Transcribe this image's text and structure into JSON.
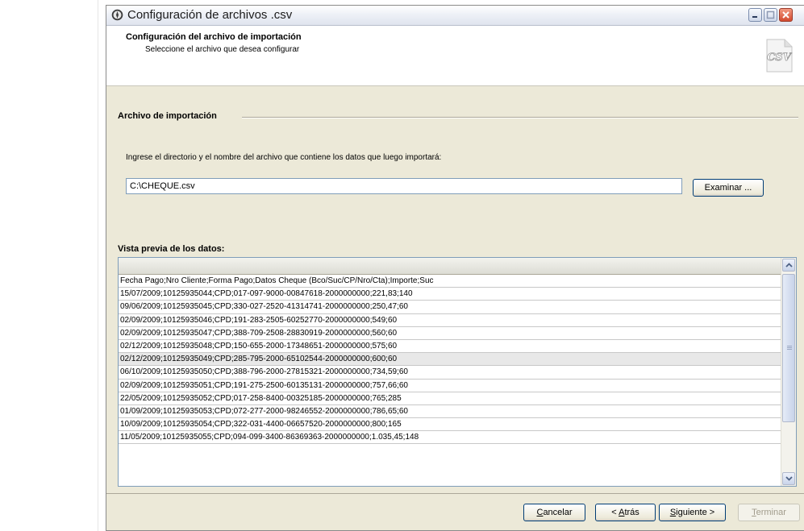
{
  "window": {
    "title": "Configuración de archivos .csv",
    "header_title": "Configuración del archivo de importación",
    "header_subtitle": "Seleccione el archivo que desea configurar",
    "icon_label": "CSV"
  },
  "import_section": {
    "title": "Archivo de importación",
    "instruction": "Ingrese el directorio y el nombre del archivo que contiene los datos que luego importará:",
    "path_value": "C:\\CHEQUE.csv",
    "browse_label": "Examinar ..."
  },
  "preview": {
    "title": "Vista previa de los datos:",
    "rows": [
      "Fecha Pago;Nro Cliente;Forma Pago;Datos Cheque (Bco/Suc/CP/Nro/Cta);Importe;Suc",
      "15/07/2009;10125935044;CPD;017-097-9000-00847618-2000000000;221,83;140",
      "09/06/2009;10125935045;CPD;330-027-2520-41314741-2000000000;250,47;60",
      "02/09/2009;10125935046;CPD;191-283-2505-60252770-2000000000;549;60",
      "02/09/2009;10125935047;CPD;388-709-2508-28830919-2000000000;560;60",
      "02/12/2009;10125935048;CPD;150-655-2000-17348651-2000000000;575;60",
      "02/12/2009;10125935049;CPD;285-795-2000-65102544-2000000000;600;60",
      "06/10/2009;10125935050;CPD;388-796-2000-27815321-2000000000;734,59;60",
      "02/09/2009;10125935051;CPD;191-275-2500-60135131-2000000000;757,66;60",
      "22/05/2009;10125935052;CPD;017-258-8400-00325185-2000000000;765;285",
      "01/09/2009;10125935053;CPD;072-277-2000-98246552-2000000000;786,65;60",
      "10/09/2009;10125935054;CPD;322-031-4400-06657520-2000000000;800;165",
      "11/05/2009;10125935055;CPD;094-099-3400-86369363-2000000000;1.035,45;148"
    ],
    "selected_row_index": 6
  },
  "footer": {
    "cancel_label": "Cancelar",
    "back_label": "< Atrás",
    "next_label": "Siguiente >",
    "finish_label": "Terminar"
  },
  "colors": {
    "dialog_bg": "#ece9d8",
    "border_blue": "#7f9db9",
    "close_red": "#d24a2f"
  }
}
